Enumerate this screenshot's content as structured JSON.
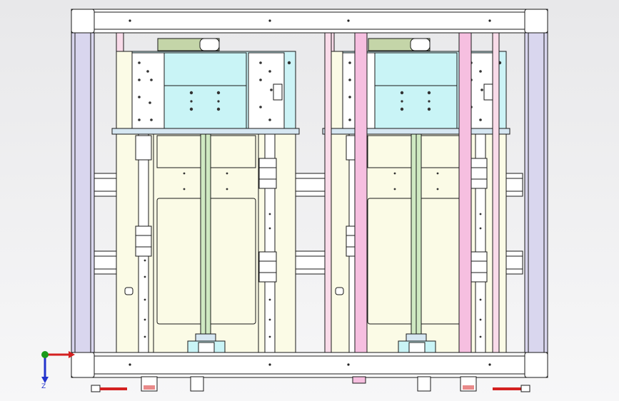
{
  "view": {
    "background_top": "#e8e8ea",
    "background_bottom": "#f7f7f8"
  },
  "colors": {
    "frame_fill": "#ffffff",
    "frame_stroke": "#1a1a1a",
    "corner_post": "#d9d6ee",
    "rail_pink": "#f6bfe0",
    "rail_pink_light": "#f9dbe9",
    "plate": "#fbfbe6",
    "bracket": "#ccf3f6",
    "motor": "#c9f4f6",
    "shaft": "#cfe9c2",
    "belt": "#c4d5a8",
    "bearing": "#d6e7f2"
  },
  "triad": {
    "x_axis": "x-axis",
    "y_axis": "y-axis",
    "z_label": "Z",
    "x_color": "#d42020",
    "y_color": "#1a9a1a",
    "z_color": "#2233cc"
  }
}
